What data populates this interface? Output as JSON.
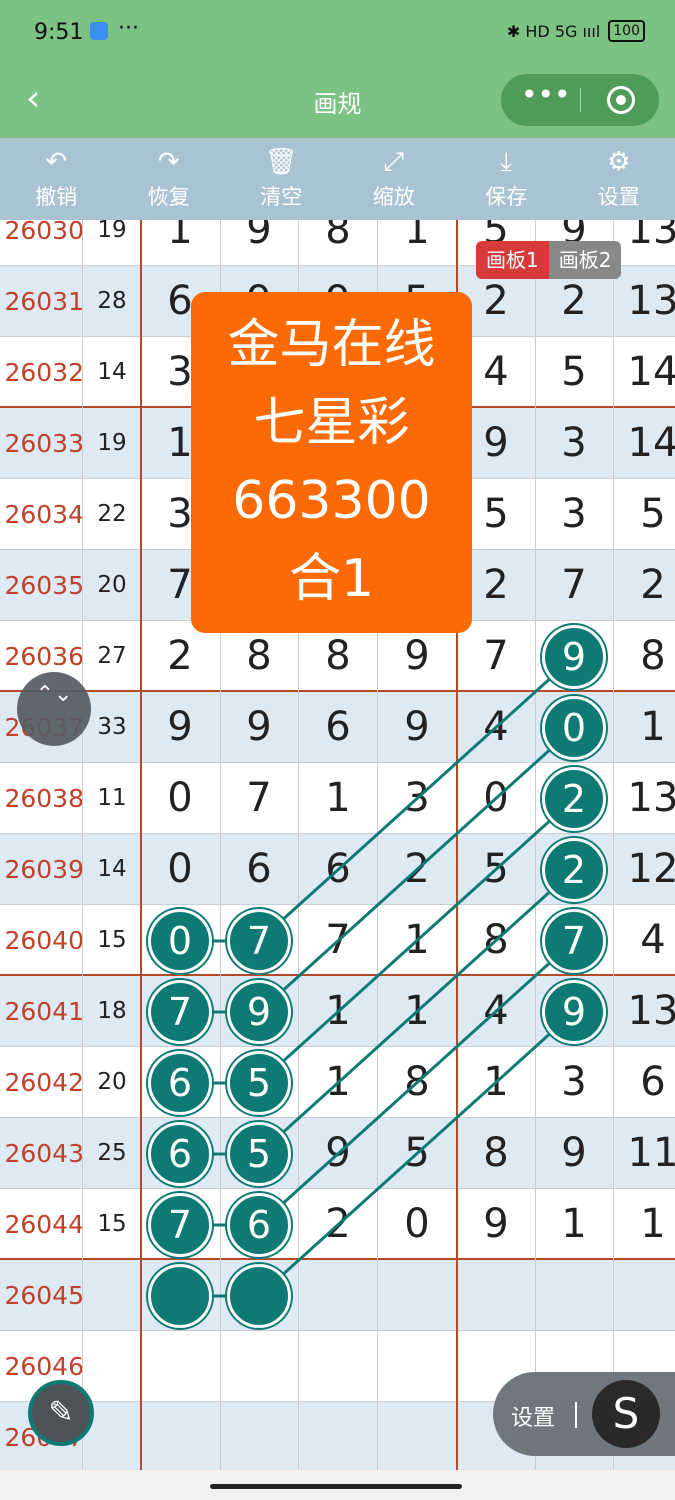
{
  "status": {
    "time": "9:51",
    "dots": "···",
    "right": "✱ HD 5G ıııl",
    "battery": "100"
  },
  "header": {
    "back": "‹",
    "title": "画规",
    "more": "•••"
  },
  "toolbar": [
    {
      "icon": "↶",
      "label": "撤销"
    },
    {
      "icon": "↷",
      "label": "恢复"
    },
    {
      "icon": "🗑",
      "label": "清空"
    },
    {
      "icon": "⤢",
      "label": "缩放"
    },
    {
      "icon": "⤓",
      "label": "保存"
    },
    {
      "icon": "⚙",
      "label": "设置"
    }
  ],
  "tabs": {
    "active": "画板1",
    "inactive": "画板2"
  },
  "promo": {
    "line1": "金马在线",
    "line2": "七星彩",
    "line3": "663300",
    "line4": "合1"
  },
  "rows": [
    {
      "id": "26030",
      "sum": "19",
      "d": [
        "1",
        "9",
        "8",
        "1",
        "5",
        "9",
        "13"
      ]
    },
    {
      "id": "26031",
      "sum": "28",
      "d": [
        "6",
        "9",
        "9",
        "5",
        "2",
        "2",
        "13"
      ]
    },
    {
      "id": "26032",
      "sum": "14",
      "d": [
        "3",
        "",
        "",
        "",
        "4",
        "5",
        "14"
      ]
    },
    {
      "id": "26033",
      "sum": "19",
      "d": [
        "1",
        "",
        "",
        "",
        "9",
        "3",
        "14"
      ]
    },
    {
      "id": "26034",
      "sum": "22",
      "d": [
        "3",
        "",
        "",
        "",
        "5",
        "3",
        "5"
      ]
    },
    {
      "id": "26035",
      "sum": "20",
      "d": [
        "7",
        "",
        "",
        "",
        "2",
        "7",
        "2"
      ]
    },
    {
      "id": "26036",
      "sum": "27",
      "d": [
        "2",
        "8",
        "8",
        "9",
        "7",
        "9",
        "8"
      ]
    },
    {
      "id": "26037",
      "sum": "33",
      "d": [
        "9",
        "9",
        "6",
        "9",
        "4",
        "0",
        "1"
      ]
    },
    {
      "id": "26038",
      "sum": "11",
      "d": [
        "0",
        "7",
        "1",
        "3",
        "0",
        "2",
        "13"
      ]
    },
    {
      "id": "26039",
      "sum": "14",
      "d": [
        "0",
        "6",
        "6",
        "2",
        "5",
        "2",
        "12"
      ]
    },
    {
      "id": "26040",
      "sum": "15",
      "d": [
        "0",
        "7",
        "7",
        "1",
        "8",
        "7",
        "4"
      ]
    },
    {
      "id": "26041",
      "sum": "18",
      "d": [
        "7",
        "9",
        "1",
        "1",
        "4",
        "9",
        "13"
      ]
    },
    {
      "id": "26042",
      "sum": "20",
      "d": [
        "6",
        "5",
        "1",
        "8",
        "1",
        "3",
        "6"
      ]
    },
    {
      "id": "26043",
      "sum": "25",
      "d": [
        "6",
        "5",
        "9",
        "5",
        "8",
        "9",
        "11"
      ]
    },
    {
      "id": "26044",
      "sum": "15",
      "d": [
        "7",
        "6",
        "2",
        "0",
        "9",
        "1",
        "1"
      ]
    },
    {
      "id": "26045",
      "sum": "",
      "d": [
        "",
        "",
        "",
        "",
        "",
        "",
        ""
      ]
    },
    {
      "id": "26046",
      "sum": "",
      "d": [
        "",
        "",
        "",
        "",
        "",
        "",
        ""
      ]
    },
    {
      "id": "26047",
      "sum": "",
      "d": [
        "",
        "",
        "",
        "",
        "",
        "",
        ""
      ]
    }
  ],
  "balls": [
    {
      "label": "9"
    },
    {
      "label": "0"
    },
    {
      "label": "2"
    },
    {
      "label": "2"
    },
    {
      "label": "7"
    },
    {
      "label": "9"
    },
    {
      "label": "0"
    },
    {
      "label": "7"
    },
    {
      "label": "7"
    },
    {
      "label": "9"
    },
    {
      "label": "6"
    },
    {
      "label": "5"
    },
    {
      "label": "6"
    },
    {
      "label": "5"
    },
    {
      "label": "7"
    },
    {
      "label": "6"
    },
    {
      "label": ""
    },
    {
      "label": ""
    }
  ],
  "floating": {
    "scroll_icon": "⌃⌄",
    "pen_icon": "✎",
    "settings_label": "设置",
    "settings_icon": "S"
  },
  "colors": {
    "header": "#7cc283",
    "toolbar": "#a9c3d3",
    "promo": "#fb6a05",
    "ball": "#0f7a74",
    "id_text": "#c0422a",
    "separator": "#b54a2a"
  }
}
